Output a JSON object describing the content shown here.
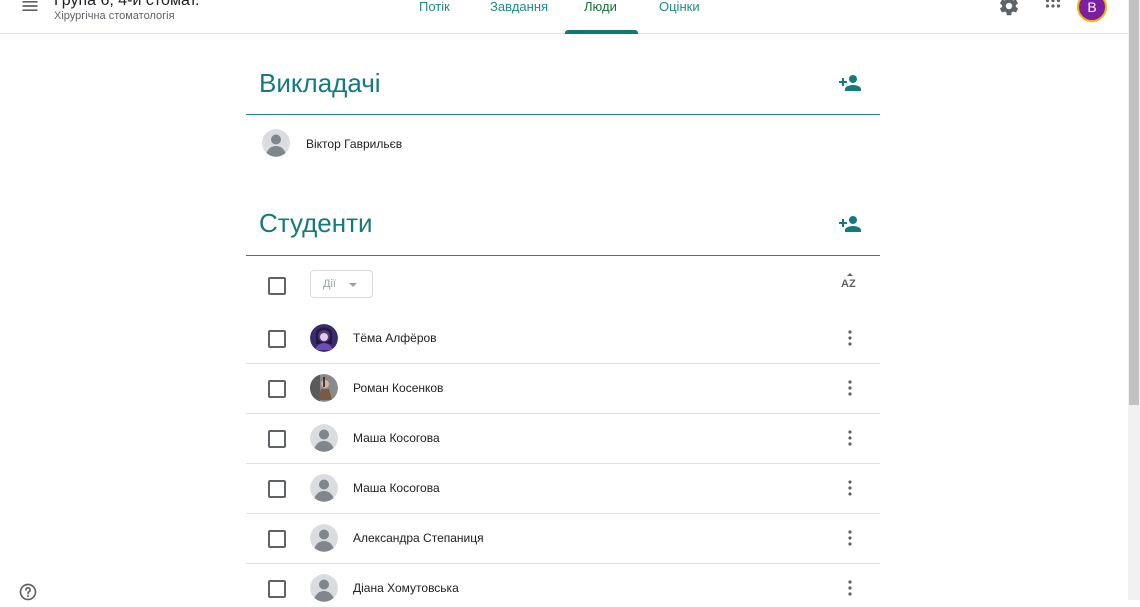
{
  "header": {
    "class_title": "Група 6, 4-й стомат.",
    "class_subtitle": "Хірургічна стоматологія",
    "tabs": [
      {
        "label": "Потік"
      },
      {
        "label": "Завдання"
      },
      {
        "label": "Люди",
        "active": true
      },
      {
        "label": "Оцінки"
      }
    ],
    "avatar_letter": "B"
  },
  "teachers": {
    "title": "Викладачі",
    "people": [
      {
        "name": "Віктор Гаврильєв"
      }
    ]
  },
  "students": {
    "title": "Студенти",
    "actions_label": "Дії",
    "list": [
      {
        "name": "Тёма Алфёров",
        "avatar": "photo"
      },
      {
        "name": "Роман Косенков",
        "avatar": "photo"
      },
      {
        "name": "Маша Косогова",
        "avatar": "default"
      },
      {
        "name": "Маша Косогова",
        "avatar": "default"
      },
      {
        "name": "Александра Степаниця",
        "avatar": "default"
      },
      {
        "name": "Діана Хомутовська",
        "avatar": "default"
      }
    ]
  },
  "icons": {
    "menu": "menu-icon",
    "settings": "gear-icon",
    "apps": "apps-grid-icon",
    "add_person": "person-add-icon",
    "sort": "sort-az-icon",
    "more": "more-vert-icon",
    "help": "help-icon"
  },
  "colors": {
    "accent": "#137a7f",
    "tab": "#1e8e84",
    "avatar_bg": "#7b1fa2"
  }
}
